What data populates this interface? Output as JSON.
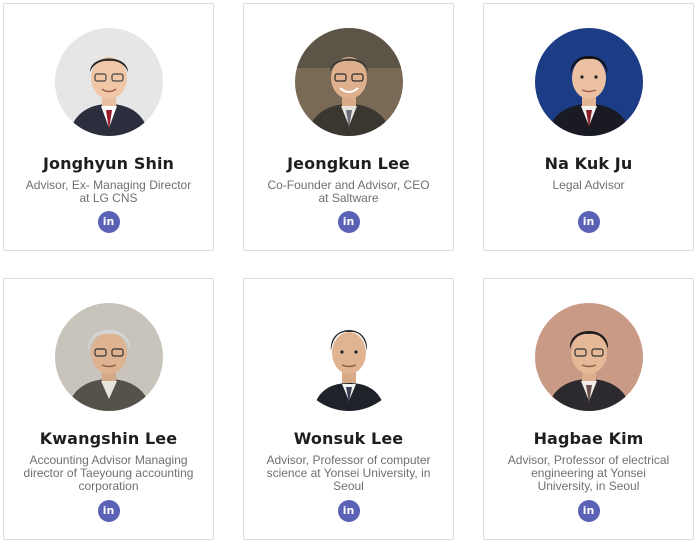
{
  "team": [
    {
      "name": "Jonghyun Shin",
      "role": "Advisor, Ex- Managing Director at LG CNS",
      "social_icon": "linkedin-icon",
      "social_glyph": "in"
    },
    {
      "name": "Jeongkun Lee",
      "role": "Co-Founder and Advisor, CEO at Saltware",
      "social_icon": "linkedin-icon",
      "social_glyph": "in"
    },
    {
      "name": "Na Kuk Ju",
      "role": "Legal Advisor",
      "social_icon": "linkedin-icon",
      "social_glyph": "in"
    },
    {
      "name": "Kwangshin Lee",
      "role": "Accounting Advisor Managing director of Taeyoung accounting corporation",
      "social_icon": "linkedin-icon",
      "social_glyph": "in"
    },
    {
      "name": "Wonsuk Lee",
      "role": "Advisor, Professor of computer science at Yonsei University, in Seoul",
      "social_icon": "linkedin-icon",
      "social_glyph": "in"
    },
    {
      "name": "Hagbae Kim",
      "role": "Advisor, Professor of electrical engineering at Yonsei University, in Seoul",
      "social_icon": "linkedin-icon",
      "social_glyph": "in"
    }
  ],
  "colors": {
    "linkedin_button": "#5b61b4",
    "card_border": "#dcdcdc",
    "name_text": "#1e1e1e",
    "role_text": "#707070"
  }
}
